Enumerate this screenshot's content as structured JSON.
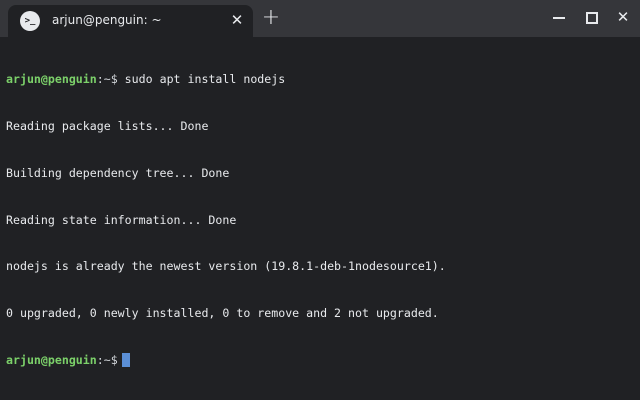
{
  "colors": {
    "titlebar": "#35363a",
    "background": "#202124",
    "text": "#e8eaed",
    "prompt_user": "#7cd16a",
    "cursor": "#5b8fd6"
  },
  "tab": {
    "icon_glyph": ">_",
    "icon_name": "terminal-app-icon",
    "title": "arjun@penguin: ~",
    "close_glyph": "✕"
  },
  "new_tab_glyph": "+",
  "window_controls": {
    "minimize": "minimize-icon",
    "maximize": "maximize-icon",
    "close_glyph": "✕"
  },
  "terminal": {
    "prompt_user": "arjun@penguin",
    "prompt_path": ":~$",
    "command": " sudo apt install nodejs",
    "output": [
      "Reading package lists... Done",
      "Building dependency tree... Done",
      "Reading state information... Done",
      "nodejs is already the newest version (19.8.1-deb-1nodesource1).",
      "0 upgraded, 0 newly installed, 0 to remove and 2 not upgraded."
    ],
    "final_prompt_user": "arjun@penguin",
    "final_prompt_path": ":~$"
  }
}
